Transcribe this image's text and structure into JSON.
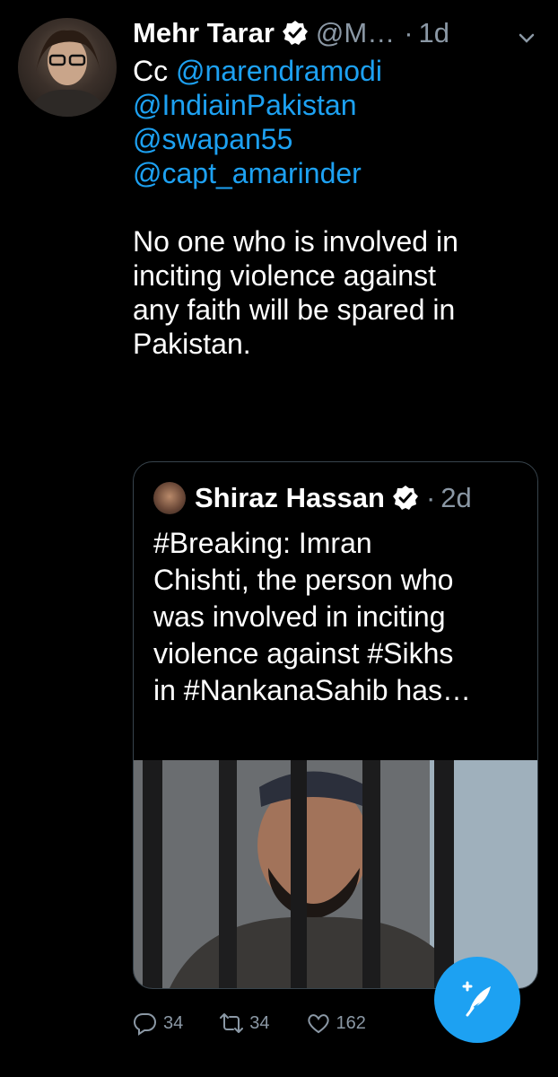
{
  "tweet": {
    "author_name": "Mehr Tarar",
    "author_handle": "@M…",
    "time": "1d",
    "separator": "·",
    "mentions_intro": "Cc",
    "mentions": [
      "@narendramodi",
      "@IndiainPakistan",
      "@swapan55",
      "@capt_amarinder"
    ],
    "body_lines": [
      "No one who is involved in",
      "inciting violence against",
      "any faith will be spared in",
      "Pakistan."
    ]
  },
  "quoted": {
    "author_name": "Shiraz Hassan",
    "time": "2d",
    "separator": "·",
    "text_lines": [
      "#Breaking: Imran",
      "Chishti, the person who",
      "was involved in inciting",
      "violence against #Sikhs",
      "in #NankanaSahib has…"
    ]
  },
  "actions": {
    "replies": "34",
    "retweets": "34",
    "likes": "162"
  },
  "icons": {
    "verified": "verified-badge-icon",
    "more": "chevron-down-icon",
    "reply": "reply-icon",
    "retweet": "retweet-icon",
    "like": "heart-icon",
    "compose": "compose-tweet-icon"
  },
  "colors": {
    "background": "#000000",
    "accent": "#1da1f2",
    "muted": "#8b98a5"
  }
}
